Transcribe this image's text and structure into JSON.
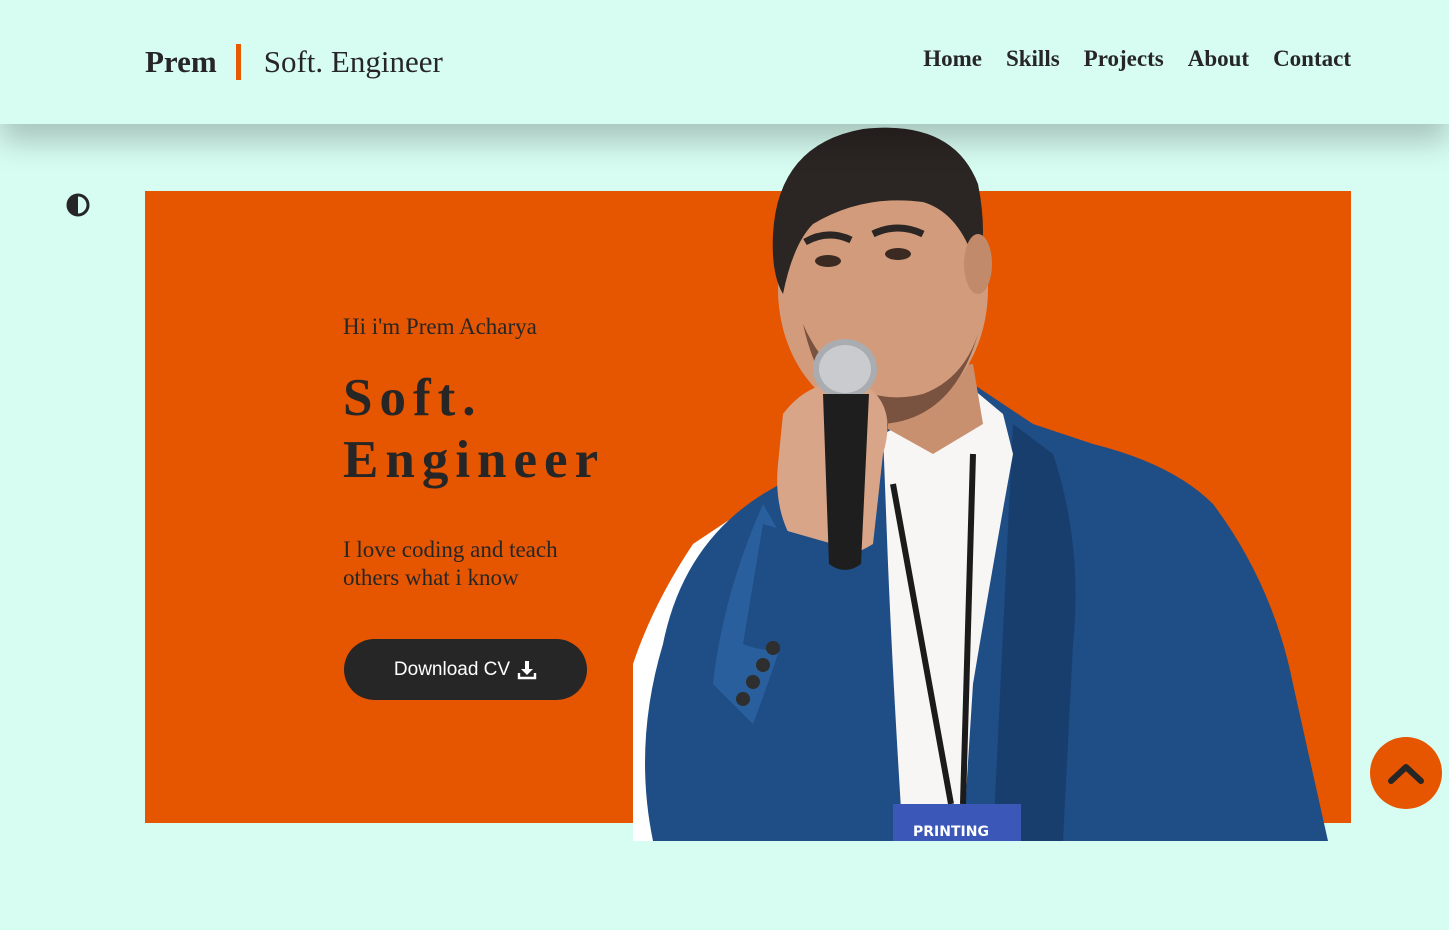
{
  "header": {
    "brand_name": "Prem",
    "brand_role": "Soft. Engineer",
    "nav": [
      "Home",
      "Skills",
      "Projects",
      "About",
      "Contact"
    ]
  },
  "theme_toggle": {
    "icon": "contrast-icon"
  },
  "hero": {
    "greeting": "Hi i'm Prem Acharya",
    "title": "Soft. Engineer",
    "tagline": "I love coding and teach others what i know",
    "download_label": "Download CV",
    "download_icon": "download-icon"
  },
  "photo": {
    "badge_text": "PRINTING"
  },
  "scroll_top": {
    "icon": "chevron-up-icon"
  },
  "colors": {
    "background": "#d7fdf2",
    "accent": "#e65500",
    "text": "#262626",
    "button": "#262626",
    "button_text": "#ffffff"
  }
}
